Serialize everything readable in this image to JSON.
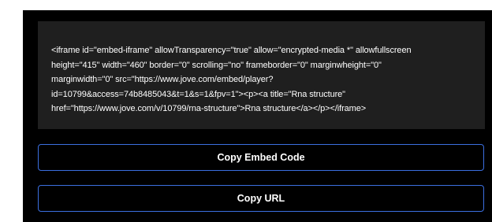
{
  "embed": {
    "code_lines": [
      "<iframe id=\"embed-iframe\" allowTransparency=\"true\" allow=\"encrypted-media *\" allowfullscreen",
      "height=\"415\" width=\"460\" border=\"0\" scrolling=\"no\" frameborder=\"0\" marginwheight=\"0\"",
      "marginwidth=\"0\" src=\"https://www.jove.com/embed/player?",
      "id=10799&access=74b8485043&t=1&s=1&fpv=1\"><p><a title=\"Rna structure\"",
      "href=\"https://www.jove.com/v/10799/rna-structure\">Rna structure</a></p></iframe>"
    ]
  },
  "buttons": {
    "copy_embed_label": "Copy Embed Code",
    "copy_url_label": "Copy URL"
  },
  "colors": {
    "panel_bg": "#000000",
    "code_bg": "#1f1f1f",
    "button_border": "#3b6fe0",
    "text": "#ffffff"
  }
}
